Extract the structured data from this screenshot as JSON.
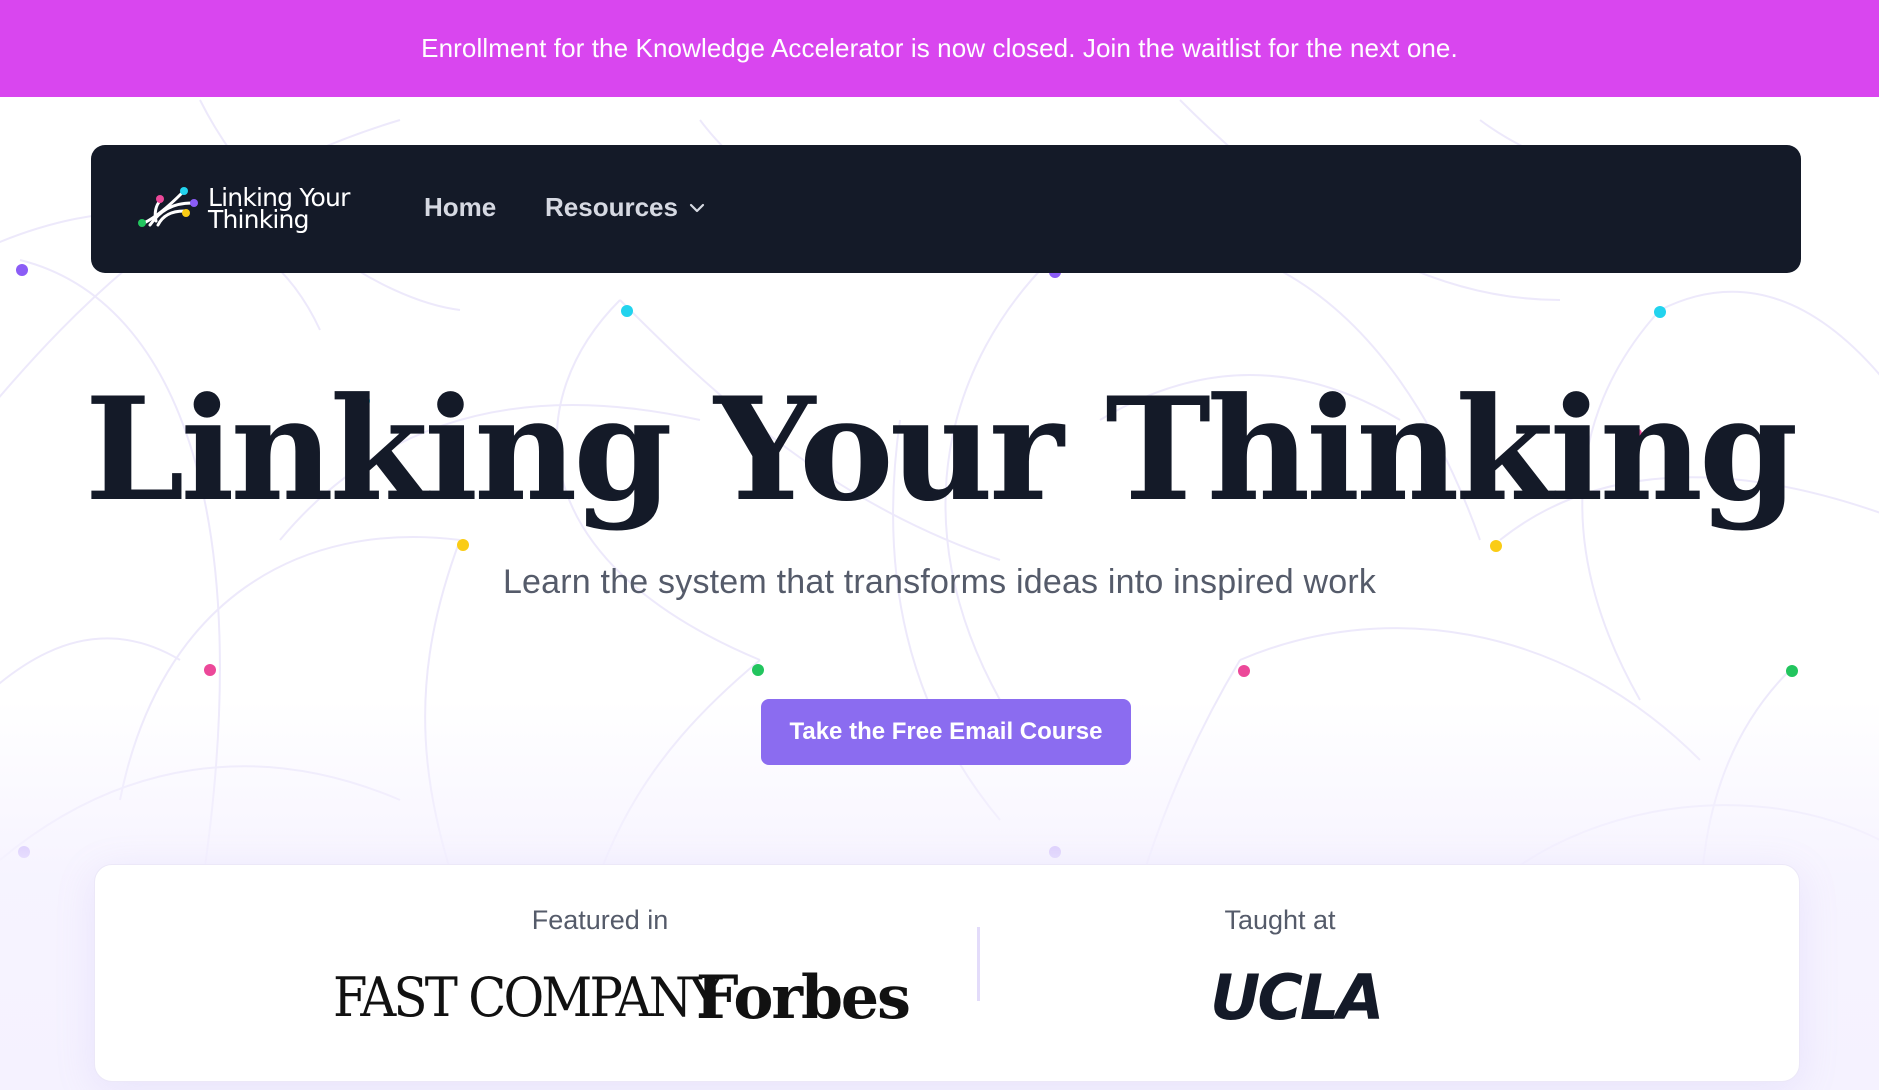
{
  "banner": {
    "text": "Enrollment for the Knowledge Accelerator is now closed. Join the waitlist for the next one."
  },
  "nav": {
    "logo_line1": "Linking Your",
    "logo_line2": "Thinking",
    "home": "Home",
    "resources": "Resources",
    "resources_icon": "chevron-down-icon"
  },
  "hero": {
    "title": "Linking Your Thinking",
    "subtitle": "Learn the system that transforms ideas into inspired work",
    "cta": "Take the Free Email Course"
  },
  "featured": {
    "featured_label": "Featured in",
    "taught_label": "Taught at",
    "logos": [
      "FAST COMPANY",
      "Forbes",
      "UCLA"
    ]
  },
  "colors": {
    "banner": "#d946ef",
    "navbar": "#141a28",
    "cta": "#8b6cf0",
    "dot_purple": "#8b5cf6",
    "dot_cyan": "#22d3ee",
    "dot_yellow": "#facc15",
    "dot_pink": "#ec4899",
    "dot_green": "#22c55e"
  }
}
